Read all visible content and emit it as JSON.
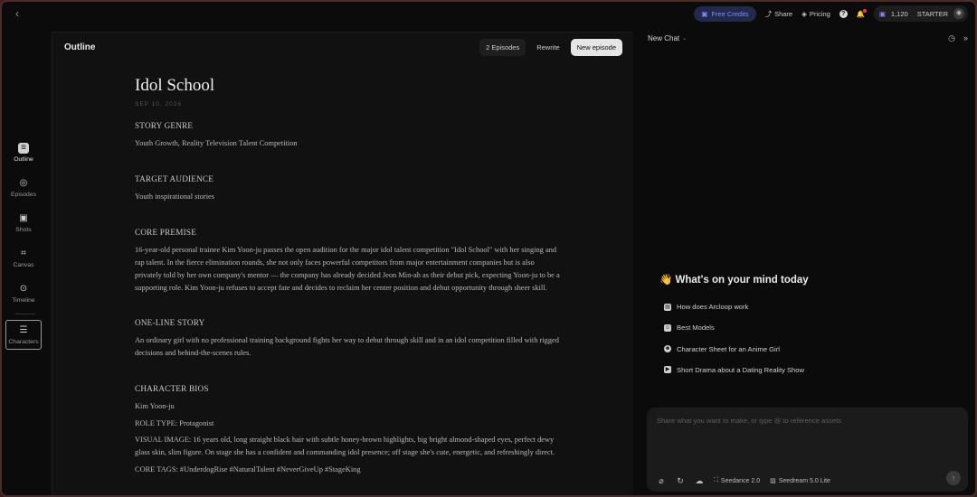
{
  "topbar": {
    "credits_label": "Free Credits",
    "share_label": "Share",
    "pricing_label": "Pricing",
    "credit_count": "1,120",
    "plan": "STARTER"
  },
  "sidebar": {
    "items": [
      {
        "label": "Outline",
        "icon": "document-icon"
      },
      {
        "label": "Episodes",
        "icon": "episodes-icon"
      },
      {
        "label": "Shots",
        "icon": "shots-icon"
      },
      {
        "label": "Canvas",
        "icon": "canvas-icon"
      },
      {
        "label": "Timeline",
        "icon": "timeline-icon"
      },
      {
        "label": "Characters",
        "icon": "characters-icon"
      }
    ]
  },
  "doc": {
    "header_title": "Outline",
    "episodes_btn": "2 Episodes",
    "rewrite_btn": "Rewrite",
    "new_episode_btn": "New episode",
    "title": "Idol School",
    "date": "SEP 10, 2026",
    "sections": {
      "genre_head": "STORY GENRE",
      "genre_text": "Youth Growth, Reality Television Talent Competition",
      "audience_head": "TARGET AUDIENCE",
      "audience_text": "Youth inspirational stories",
      "premise_head": "CORE PREMISE",
      "premise_text": "16-year-old personal trainee Kim Yoon-ju passes the open audition for the major idol talent competition \"Idol School\" with her singing and rap talent. In the fierce elimination rounds, she not only faces powerful competitors from major entertainment companies but is also privately told by her own company's mentor — the company has already decided Jeon Min-ah as their debut pick, expecting Yoon-ju to be a supporting role. Kim Yoon-ju refuses to accept fate and decides to reclaim her center position and debut opportunity through sheer skill.",
      "oneline_head": "ONE-LINE STORY",
      "oneline_text": "An ordinary girl with no professional training background fights her way to debut through skill and in an idol competition filled with rigged decisions and behind-the-scenes rules.",
      "bios_head": "CHARACTER BIOS",
      "bio_name": "Kim Yoon-ju",
      "bio_role": "ROLE TYPE: Protagonist",
      "bio_visual": "VISUAL IMAGE: 16 years old, long straight black hair with subtle honey-brown highlights, big bright almond-shaped eyes, perfect dewy glass skin, slim figure. On stage she has a confident and commanding idol presence; off stage she's cute, energetic, and refreshingly direct.",
      "bio_tags": "CORE TAGS: #UnderdogRise #NaturalTalent #NeverGiveUp #StageKing"
    }
  },
  "chat": {
    "title": "New Chat",
    "greeting_emoji": "👋",
    "greeting": "What's on your mind today",
    "suggestions": [
      {
        "label": "How does Arcloop work",
        "icon": "book-icon"
      },
      {
        "label": "Best Models",
        "icon": "people-icon"
      },
      {
        "label": "Character Sheet for an Anime Girl",
        "icon": "face-icon"
      },
      {
        "label": "Short Drama about a Dating Reality Show",
        "icon": "video-icon"
      }
    ],
    "input_placeholder": "Share what you want to make, or type @ to reference assets",
    "model_video": "Seedance 2.0",
    "model_image": "Seedream 5.0 Lite"
  }
}
